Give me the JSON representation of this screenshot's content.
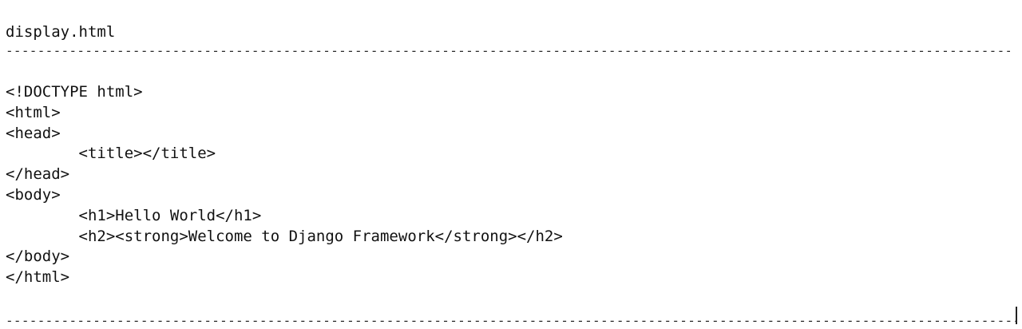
{
  "file": {
    "name": "display.html",
    "separator": "------------------------------------------------------------------------------------------------------------------------------------------------------------------------"
  },
  "code": {
    "lines": [
      "<!DOCTYPE html>",
      "<html>",
      "<head>",
      "        <title></title>",
      "</head>",
      "<body>",
      "        <h1>Hello World</h1>",
      "        <h2><strong>Welcome to Django Framework</strong></h2>",
      "</body>",
      "</html>"
    ]
  }
}
